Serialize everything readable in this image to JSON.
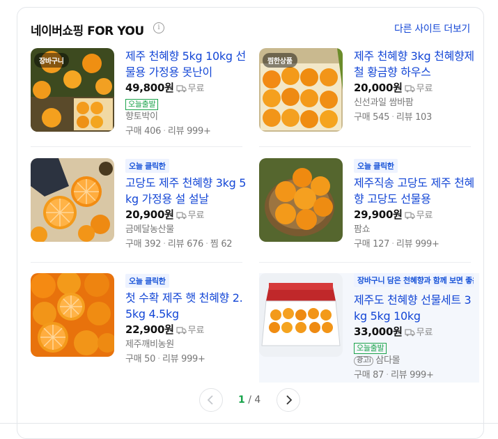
{
  "header": {
    "title": "네이버쇼핑 FOR YOU",
    "info_icon": "i",
    "more_link": "다른 사이트 더보기"
  },
  "products": [
    {
      "thumb_badge": "장바구니",
      "title": "제주 천혜향 5kg 10kg 선물용 가정용 못난이",
      "price": "49,800원",
      "shipping": "무료",
      "delivery_badge": "오늘출발",
      "store": "향토박이",
      "purchases": "구매 406",
      "reviews": "리뷰 999+"
    },
    {
      "thumb_badge": "찜한상품",
      "title": "제주 천혜향 3kg 천혜향제철 황금향 하우스",
      "price": "20,000원",
      "shipping": "무료",
      "store": "신선과일 쌈바팜",
      "purchases": "구매 545",
      "reviews": "리뷰 103"
    },
    {
      "tag": "오늘 클릭한",
      "title": "고당도 제주 천혜향 3kg 5kg 가정용 설 설날",
      "price": "20,900원",
      "shipping": "무료",
      "store": "금메달농산물",
      "purchases": "구매 392",
      "reviews": "리뷰 676",
      "saves": "찜 62"
    },
    {
      "tag": "오늘 클릭한",
      "title": "제주직송 고당도 제주 천혜향 고당도 선물용",
      "price": "29,900원",
      "shipping": "무료",
      "store": "팜쇼",
      "purchases": "구매 127",
      "reviews": "리뷰 999+"
    },
    {
      "tag": "오늘 클릭한",
      "title": "첫 수확 제주 햇 천혜향 2.5kg 4.5kg",
      "price": "22,900원",
      "shipping": "무료",
      "store": "제주깨비농원",
      "purchases": "구매 50",
      "reviews": "리뷰 999+"
    },
    {
      "tag": "장바구니 담은 천혜향과 함께 보면 좋은",
      "title": "제주도 천혜향 선물세트 3kg 5kg 10kg",
      "price": "33,000원",
      "shipping": "무료",
      "delivery_badge": "오늘출발",
      "ad_label": "광고",
      "ad_icon": "i",
      "store": "삼다몰",
      "purchases": "구매 87",
      "reviews": "리뷰 999+"
    }
  ],
  "pager": {
    "current": "1",
    "total": "/ 4"
  },
  "colors": {
    "link_blue": "#1447d6",
    "tag_blue": "#1a55d8",
    "green": "#1aa34a",
    "pager_green": "#17a34a"
  },
  "icons": [
    "info-icon",
    "truck-icon",
    "chevron-left-icon",
    "chevron-right-icon"
  ]
}
